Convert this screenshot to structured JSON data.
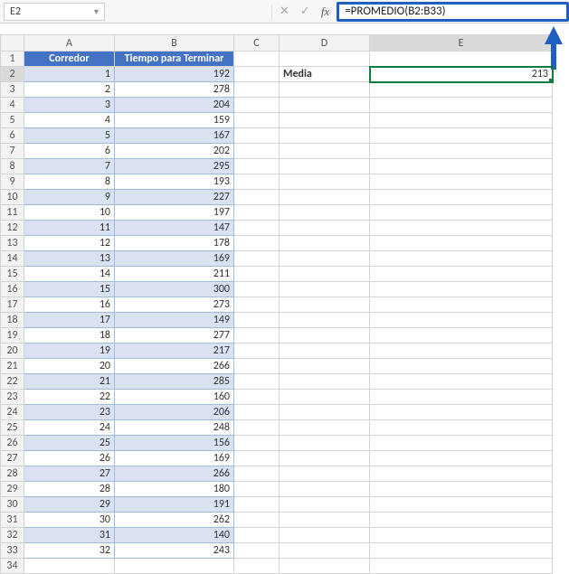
{
  "namebox": {
    "value": "E2"
  },
  "formula_bar": {
    "cancel_glyph": "✕",
    "enter_glyph": "✓",
    "fx_label": "fx",
    "formula": "=PROMEDIO(B2:B33)"
  },
  "columns": [
    "A",
    "B",
    "C",
    "D",
    "E"
  ],
  "headers": {
    "A": "Corredor",
    "B": "Tiempo para Terminar"
  },
  "labels": {
    "D2": "Media"
  },
  "result": {
    "E2": "213"
  },
  "rows": [
    {
      "n": 1,
      "A": "",
      "B": ""
    },
    {
      "n": 2,
      "A": "1",
      "B": "192"
    },
    {
      "n": 3,
      "A": "2",
      "B": "278"
    },
    {
      "n": 4,
      "A": "3",
      "B": "204"
    },
    {
      "n": 5,
      "A": "4",
      "B": "159"
    },
    {
      "n": 6,
      "A": "5",
      "B": "167"
    },
    {
      "n": 7,
      "A": "6",
      "B": "202"
    },
    {
      "n": 8,
      "A": "7",
      "B": "295"
    },
    {
      "n": 9,
      "A": "8",
      "B": "193"
    },
    {
      "n": 10,
      "A": "9",
      "B": "227"
    },
    {
      "n": 11,
      "A": "10",
      "B": "197"
    },
    {
      "n": 12,
      "A": "11",
      "B": "147"
    },
    {
      "n": 13,
      "A": "12",
      "B": "178"
    },
    {
      "n": 14,
      "A": "13",
      "B": "169"
    },
    {
      "n": 15,
      "A": "14",
      "B": "211"
    },
    {
      "n": 16,
      "A": "15",
      "B": "300"
    },
    {
      "n": 17,
      "A": "16",
      "B": "273"
    },
    {
      "n": 18,
      "A": "17",
      "B": "149"
    },
    {
      "n": 19,
      "A": "18",
      "B": "277"
    },
    {
      "n": 20,
      "A": "19",
      "B": "217"
    },
    {
      "n": 21,
      "A": "20",
      "B": "266"
    },
    {
      "n": 22,
      "A": "21",
      "B": "285"
    },
    {
      "n": 23,
      "A": "22",
      "B": "160"
    },
    {
      "n": 24,
      "A": "23",
      "B": "206"
    },
    {
      "n": 25,
      "A": "24",
      "B": "248"
    },
    {
      "n": 26,
      "A": "25",
      "B": "156"
    },
    {
      "n": 27,
      "A": "26",
      "B": "169"
    },
    {
      "n": 28,
      "A": "27",
      "B": "266"
    },
    {
      "n": 29,
      "A": "28",
      "B": "180"
    },
    {
      "n": 30,
      "A": "29",
      "B": "191"
    },
    {
      "n": 31,
      "A": "30",
      "B": "262"
    },
    {
      "n": 32,
      "A": "31",
      "B": "140"
    },
    {
      "n": 33,
      "A": "32",
      "B": "243"
    },
    {
      "n": 34,
      "A": "",
      "B": ""
    }
  ]
}
